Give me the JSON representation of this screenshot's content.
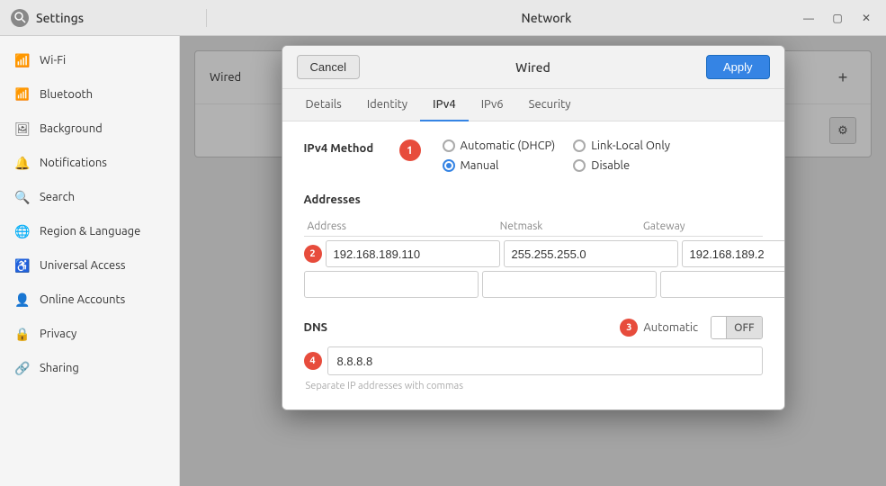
{
  "titlebar": {
    "app_icon": "⚙",
    "settings_title": "Settings",
    "network_title": "Network",
    "minimize_icon": "—",
    "maximize_icon": "▢",
    "close_icon": "✕"
  },
  "sidebar": {
    "items": [
      {
        "id": "wifi",
        "icon": "📶",
        "label": "Wi-Fi"
      },
      {
        "id": "bluetooth",
        "icon": "𝐁",
        "label": "Bluetooth"
      },
      {
        "id": "background",
        "icon": "🖼",
        "label": "Background"
      },
      {
        "id": "notifications",
        "icon": "🔔",
        "label": "Notifications"
      },
      {
        "id": "search",
        "icon": "🔍",
        "label": "Search"
      },
      {
        "id": "region",
        "icon": "🌐",
        "label": "Region & Language"
      },
      {
        "id": "universal",
        "icon": "♿",
        "label": "Universal Access"
      },
      {
        "id": "online-accounts",
        "icon": "👤",
        "label": "Online Accounts"
      },
      {
        "id": "privacy",
        "icon": "🔒",
        "label": "Privacy"
      },
      {
        "id": "sharing",
        "icon": "🔗",
        "label": "Sharing"
      }
    ]
  },
  "network_panel": {
    "plus_icon": "+",
    "gear_icon": "⚙"
  },
  "dialog": {
    "title": "Wired",
    "cancel_label": "Cancel",
    "apply_label": "Apply",
    "tabs": [
      {
        "id": "details",
        "label": "Details"
      },
      {
        "id": "identity",
        "label": "Identity"
      },
      {
        "id": "ipv4",
        "label": "IPv4",
        "active": true
      },
      {
        "id": "ipv6",
        "label": "IPv6"
      },
      {
        "id": "security",
        "label": "Security"
      }
    ],
    "ipv4": {
      "method_label": "IPv4 Method",
      "methods_left": [
        {
          "id": "dhcp",
          "label": "Automatic (DHCP)",
          "checked": false
        },
        {
          "id": "manual",
          "label": "Manual",
          "checked": true
        }
      ],
      "methods_right": [
        {
          "id": "link-local",
          "label": "Link-Local Only",
          "checked": false
        },
        {
          "id": "disable",
          "label": "Disable",
          "checked": false
        }
      ],
      "addresses_label": "Addresses",
      "address_col": "Address",
      "netmask_col": "Netmask",
      "gateway_col": "Gateway",
      "rows": [
        {
          "address": "192.168.189.110",
          "netmask": "255.255.255.0",
          "gateway": "192.168.189.2"
        },
        {
          "address": "",
          "netmask": "",
          "gateway": ""
        }
      ],
      "delete_icon": "✕",
      "dns_label": "DNS",
      "auto_label": "Automatic",
      "toggle_on": "",
      "toggle_off": "OFF",
      "dns_value": "8.8.8.8",
      "dns_placeholder": "",
      "dns_hint": "Separate IP addresses with commas"
    }
  },
  "badges": {
    "badge1": "1",
    "badge2": "2",
    "badge3": "3",
    "badge4": "4"
  }
}
